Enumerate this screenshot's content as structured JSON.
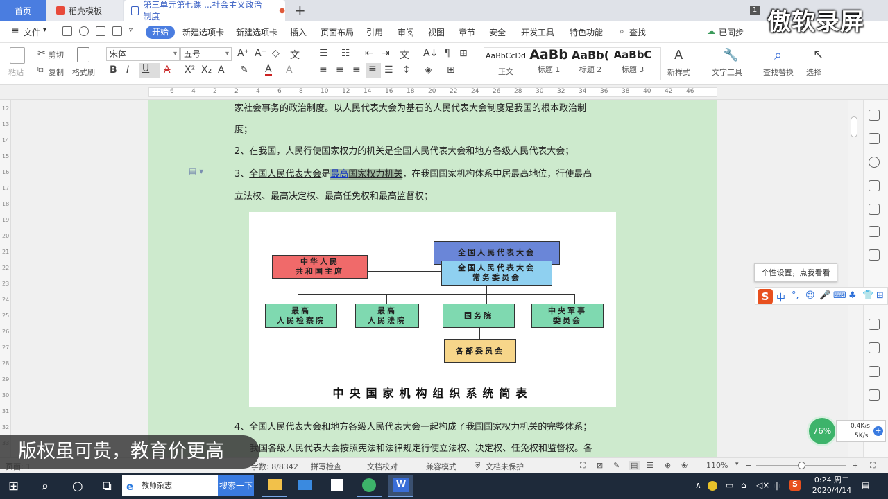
{
  "tabs": {
    "home": "首页",
    "template": "稻壳模板",
    "document": "第三单元第七课 ...社会主义政治制度",
    "add": "+",
    "window_count": "1"
  },
  "recorder_watermark": "傲软录屏",
  "menu": {
    "file": "文件",
    "start": "开始",
    "items": [
      "新建选项卡",
      "新建选项卡",
      "插入",
      "页面布局",
      "引用",
      "审阅",
      "视图",
      "章节",
      "安全",
      "开发工具",
      "特色功能"
    ],
    "search": "查找",
    "sync": "已同步"
  },
  "ribbon": {
    "paste": "粘贴",
    "cut": "剪切",
    "copy": "复制",
    "format_painter": "格式刷",
    "font_name": "宋体",
    "font_size": "五号",
    "styles": [
      {
        "preview": "AaBbCcDd",
        "name": "正文"
      },
      {
        "preview": "AaBb",
        "name": "标题 1"
      },
      {
        "preview": "AaBb(",
        "name": "标题 2"
      },
      {
        "preview": "AaBbC",
        "name": "标题 3"
      }
    ],
    "new_style": "新样式",
    "text_tools": "文字工具",
    "find_replace": "查找替换",
    "select": "选择"
  },
  "ruler": {
    "h_ticks": [
      "6",
      "4",
      "2",
      "2",
      "4",
      "6",
      "8",
      "10",
      "12",
      "14",
      "16",
      "18",
      "20",
      "22",
      "24",
      "26",
      "28",
      "30",
      "32",
      "34",
      "36",
      "38",
      "40",
      "42",
      "46"
    ],
    "v_ticks": [
      "12",
      "13",
      "14",
      "15",
      "16",
      "17",
      "18",
      "19",
      "20",
      "21",
      "22",
      "23",
      "24",
      "25",
      "26",
      "27",
      "28",
      "29",
      "30",
      "31",
      "32",
      "33"
    ]
  },
  "document": {
    "line1": "家社会事务的政治制度。以人民代表大会为基石的人民代表大会制度是我国的根本政治制",
    "line2": "度；",
    "p2_a": "2、在我国，人民行使国家权力的机关是",
    "p2_b": "全国人民代表大会和地方各级人民代表大会",
    "p2_c": "；",
    "p3_a": "3、",
    "p3_b": "全国人民代表大会",
    "p3_c": "是",
    "p3_d": "最高",
    "p3_e": "国家权力机关",
    "p3_f": "，在我国国家机构体系中居最高地位，行使最高",
    "p3_line2": "立法权、最高决定权、最高任免权和最高监督权；",
    "p4": "4、全国人民代表大会和地方各级人民代表大会一起构成了我国国家权力机关的完整体系；",
    "p5": "我国各级人民代表大会按照宪法和法律规定行使立法权、决定权、任免权和监督权。各"
  },
  "org_chart": {
    "title": "中央国家机构组织系统简表",
    "npc": "全国人民代表大会",
    "npc_standing": [
      "全国人民代表大会",
      "常务委员会"
    ],
    "president": [
      "中华人民",
      "共和国主席"
    ],
    "procuratorate": [
      "最高",
      "人民检察院"
    ],
    "court": [
      "最高",
      "人民法院"
    ],
    "state_council": "国务院",
    "military": [
      "中央军事",
      "委员会"
    ],
    "ministries": "各部委员会",
    "colors": {
      "npc": "#6a86d8",
      "standing": "#8fd0f0",
      "president": "#f06a6a",
      "mid": "#7fd9b0",
      "ministries": "#f7d68a"
    }
  },
  "ime": {
    "tip": "个性设置，点我看看",
    "lang": "中"
  },
  "speed": {
    "percent": "76%",
    "up": "0.4K/s",
    "down": "5K/s"
  },
  "status": {
    "page": "页面: 1",
    "words": "字数: 8/8342",
    "spell": "拼写检查",
    "proof": "文档校对",
    "compat": "兼容模式",
    "protect": "文档未保护",
    "zoom": "110%"
  },
  "caption": "版权虽可贵，教育价更高",
  "taskbar": {
    "search_placeholder": "教师杂志",
    "search_button": "搜索一下",
    "time": "0:24 周二",
    "date": "2020/4/14",
    "ime": "中"
  }
}
